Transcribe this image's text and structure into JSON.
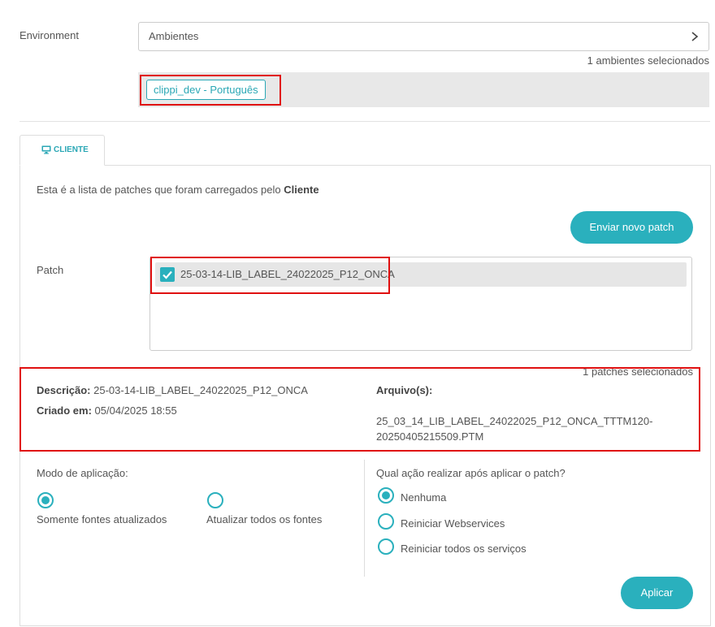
{
  "environment": {
    "label": "Environment",
    "select_value": "Ambientes",
    "count_text": "1 ambientes selecionados",
    "chips": [
      "clippi_dev - Português"
    ]
  },
  "tabs": [
    {
      "label": "CLIENTE",
      "icon": "monitor-icon",
      "active": true
    }
  ],
  "intro": {
    "text": "Esta é a lista de patches que foram carregados pelo ",
    "bold": "Cliente"
  },
  "buttons": {
    "send_patch": "Enviar novo patch",
    "apply": "Aplicar"
  },
  "patch": {
    "label": "Patch",
    "items": [
      {
        "name": "25-03-14-LIB_LABEL_24022025_P12_ONCA",
        "checked": true
      }
    ],
    "count_text": "1 patches selecionados"
  },
  "details": {
    "description_label": "Descrição:",
    "description_value": "25-03-14-LIB_LABEL_24022025_P12_ONCA",
    "created_label": "Criado em:",
    "created_value": "05/04/2025 18:55",
    "files_label": "Arquivo(s):",
    "files_value": "25_03_14_LIB_LABEL_24022025_P12_ONCA_TTTM120-20250405215509.PTM"
  },
  "mode": {
    "label": "Modo de aplicação:",
    "options": [
      {
        "label": "Somente fontes atualizados",
        "selected": true
      },
      {
        "label": "Atualizar todos os fontes",
        "selected": false
      }
    ]
  },
  "post_action": {
    "label": "Qual ação realizar após aplicar o patch?",
    "options": [
      {
        "label": "Nenhuma",
        "selected": true
      },
      {
        "label": "Reiniciar Webservices",
        "selected": false
      },
      {
        "label": "Reiniciar todos os serviços",
        "selected": false
      }
    ]
  },
  "colors": {
    "accent": "#2ab0bd",
    "highlight_border": "#e01010"
  }
}
